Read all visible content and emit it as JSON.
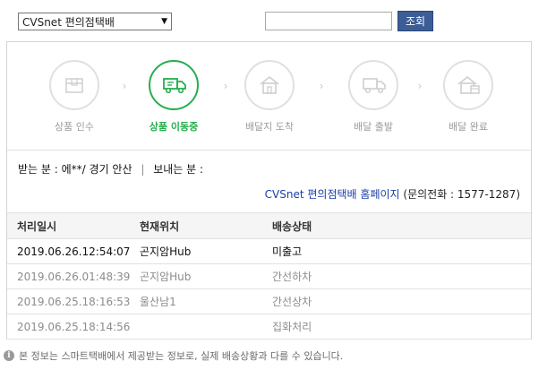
{
  "search": {
    "carrier_selected": "CVSnet 편의점택배",
    "tracking_value": "",
    "button_label": "조회"
  },
  "steps": [
    {
      "label": "상품 인수",
      "icon": "box-icon",
      "active": false
    },
    {
      "label": "상품 이동중",
      "icon": "truck-icon",
      "active": true
    },
    {
      "label": "배달지 도착",
      "icon": "house-icon",
      "active": false
    },
    {
      "label": "배달 출발",
      "icon": "delivery-truck-icon",
      "active": false
    },
    {
      "label": "배달 완료",
      "icon": "delivered-house-icon",
      "active": false
    }
  ],
  "recipient": {
    "receiver_label": "받는 분 :",
    "receiver_value": "에**/ 경기 안산",
    "sender_label": "보내는 분 :",
    "sender_value": ""
  },
  "carrier": {
    "homepage_link": "CVSnet 편의점택배 홈페이지",
    "phone_text": "(문의전화 : 1577-1287)"
  },
  "table": {
    "headers": [
      "처리일시",
      "현재위치",
      "배송상태"
    ],
    "rows": [
      {
        "time": "2019.06.26.12:54:07",
        "location": "곤지암Hub",
        "status": "미출고"
      },
      {
        "time": "2019.06.26.01:48:39",
        "location": "곤지암Hub",
        "status": "간선하차"
      },
      {
        "time": "2019.06.25.18:16:53",
        "location": "울산남1",
        "status": "간선상차"
      },
      {
        "time": "2019.06.25.18:14:56",
        "location": "",
        "status": "집화처리"
      }
    ]
  },
  "notice": "본 정보는 스마트택배에서 제공받는 정보로, 실제 배송상황과 다를 수 있습니다.",
  "colors": {
    "active": "#27ae4f",
    "button": "#3c5d95",
    "link": "#1a3faa"
  }
}
